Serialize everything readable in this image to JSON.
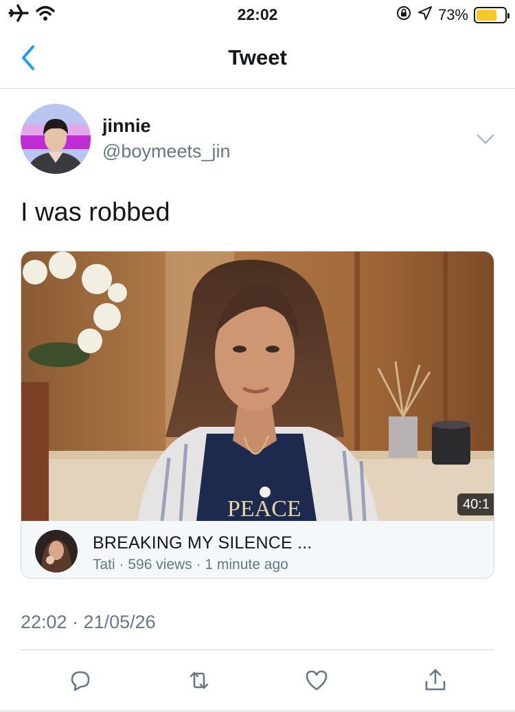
{
  "status_bar": {
    "time": "22:02",
    "battery_percent_label": "73%",
    "battery_level": 0.73,
    "icons": [
      "airplane-icon",
      "wifi-icon",
      "rotation-lock-icon",
      "location-icon",
      "battery-icon"
    ]
  },
  "nav": {
    "title": "Tweet",
    "back_icon": "chevron-left-icon"
  },
  "tweet": {
    "display_name": "jinnie",
    "handle": "@boymeets_jin",
    "text": "I was robbed",
    "timestamp": "22:02 · 21/05/26"
  },
  "video_card": {
    "duration": "40:1",
    "title": "BREAKING MY SILENCE ...",
    "channel": "Tati",
    "views": "596 views",
    "posted": "1 minute ago",
    "meta": "Tati · 596 views · 1 minute ago",
    "shirt_text": "PEACE"
  },
  "actions": [
    {
      "name": "reply",
      "icon": "reply-icon"
    },
    {
      "name": "retweet",
      "icon": "retweet-icon"
    },
    {
      "name": "like",
      "icon": "heart-icon"
    },
    {
      "name": "share",
      "icon": "share-icon"
    }
  ],
  "colors": {
    "accent": "#1da1f2",
    "icon_gray": "#657786",
    "battery": "#f7c82b",
    "divider": "#cfd4d9"
  }
}
